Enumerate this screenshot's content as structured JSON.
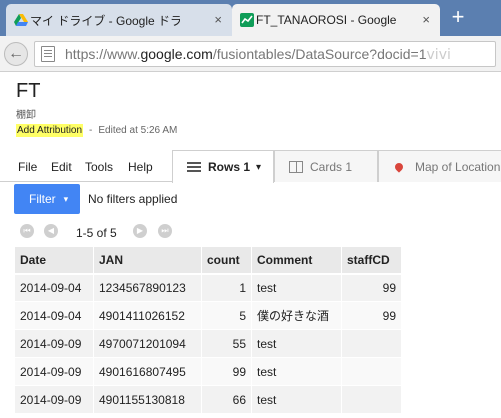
{
  "browser": {
    "tabs": [
      {
        "title": "マイ ドライブ - Google ドライブ",
        "close": "×"
      },
      {
        "title": "FT_TANAOROSI - Google",
        "close": "×"
      }
    ],
    "new_tab": "+",
    "back": "←",
    "url_prefix": "https://www.",
    "url_host": "google.com",
    "url_path": "/fusiontables/DataSource?docid=1",
    "url_blur": "ⅴⅰⅴⅰ"
  },
  "page": {
    "title": "FT",
    "subtitle": "棚卸",
    "attribution": "Add Attribution",
    "separator": "-",
    "edited": "Edited at 5:26 AM"
  },
  "menu": {
    "file": "File",
    "edit": "Edit",
    "tools": "Tools",
    "help": "Help"
  },
  "views": {
    "rows_label": "Rows 1",
    "rows_caret": "▾",
    "cards_label": "Cards 1",
    "map_label": "Map of Location"
  },
  "filter": {
    "button_label": "Filter",
    "caret": "▾",
    "status": "No filters applied"
  },
  "pager": {
    "first": "⏮",
    "prev": "◀",
    "text": "1-5 of 5",
    "next": "▶",
    "last": "⏭"
  },
  "table": {
    "columns": [
      "Date",
      "JAN",
      "count",
      "Comment",
      "staffCD"
    ],
    "rows": [
      [
        "2014-09-04",
        "1234567890123",
        "1",
        "test",
        "99"
      ],
      [
        "2014-09-04",
        "4901411026152",
        "5",
        "僕の好きな酒",
        "99"
      ],
      [
        "2014-09-09",
        "4970071201094",
        "55",
        "test",
        ""
      ],
      [
        "2014-09-09",
        "4901616807495",
        "99",
        "test",
        ""
      ],
      [
        "2014-09-09",
        "4901155130818",
        "66",
        "test",
        ""
      ]
    ]
  },
  "colors": {
    "filter_button": "#4285f4",
    "attribution_highlight": "#ffff66",
    "tabstrip": "#5b7fb0"
  }
}
